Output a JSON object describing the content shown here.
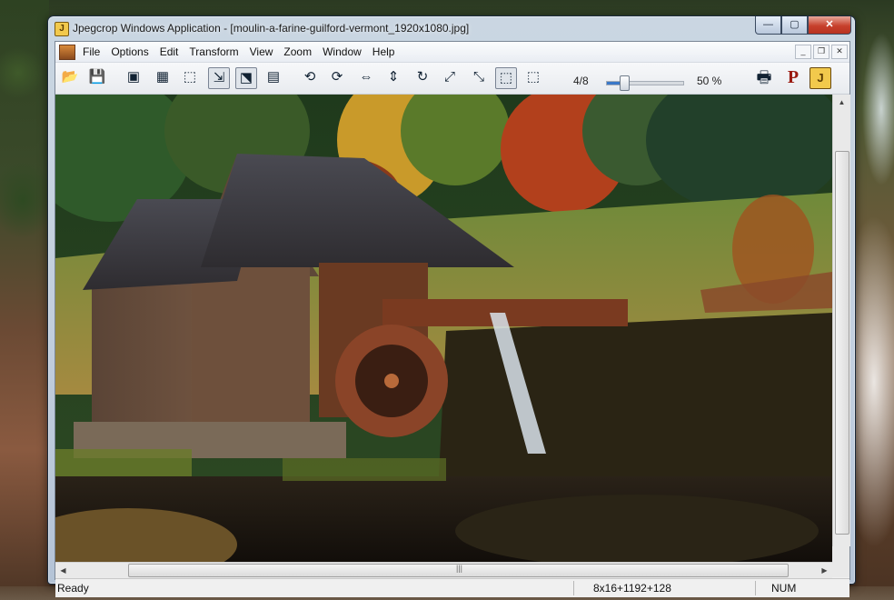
{
  "window": {
    "title": "Jpegcrop Windows Application - [moulin-a-farine-guilford-vermont_1920x1080.jpg]",
    "app_icon_letter": "J",
    "minimize_glyph": "—",
    "maximize_glyph": "▢",
    "close_glyph": "✕"
  },
  "menu": {
    "items": [
      "File",
      "Options",
      "Edit",
      "Transform",
      "View",
      "Zoom",
      "Window",
      "Help"
    ],
    "mdi": {
      "minimize": "_",
      "restore": "❐",
      "close": "✕"
    }
  },
  "toolbar": {
    "zoom_count": "4/8",
    "zoom_percent": "50 %",
    "zoom_slider_value": 0.23,
    "p_logo": "P",
    "j_logo": "J",
    "icons": {
      "open": "📂",
      "save": "💾",
      "crop-frame": "▣",
      "grid": "▦",
      "select": "⬚",
      "arrow-select": "⇲",
      "arrow-frame": "⬔",
      "gradient": "▤",
      "rotate-left": "⟲",
      "rotate-right": "⟳",
      "flip-horizontal": "⇔",
      "flip-vertical": "⇕",
      "rotate-90": "↻",
      "transpose": "⤢",
      "transverse": "⤡",
      "crop-dotted": "⬚",
      "crop-dotted-2": "⬚",
      "print": "🖶"
    }
  },
  "statusbar": {
    "left": "Ready",
    "coords": "8x16+1192+128",
    "num": "NUM"
  },
  "scrollbars": {
    "up": "▲",
    "down": "▼",
    "left": "◀",
    "right": "▶",
    "grip": "|||"
  },
  "colors": {
    "accent": "#3a78c8",
    "close_red": "#c7402c"
  }
}
